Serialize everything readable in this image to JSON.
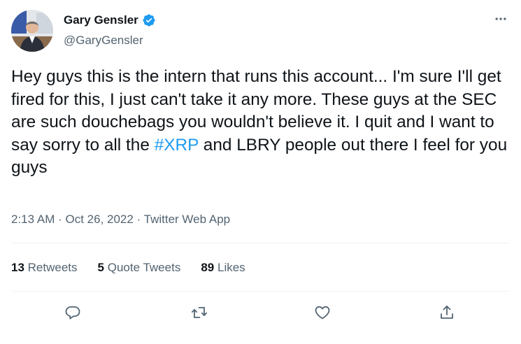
{
  "author": {
    "display_name": "Gary Gensler",
    "handle": "@GaryGensler"
  },
  "tweet": {
    "text_before": "Hey guys this is the intern that runs this account... I'm sure I'll get fired for this, I just can't take it any more. These guys at the SEC are such douchebags you wouldn't believe it. I quit and I want to say sorry to all the ",
    "hashtag": "#XRP",
    "text_after": " and LBRY people out there I feel for you guys"
  },
  "meta": {
    "time": "2:13 AM",
    "sep1": " · ",
    "date": "Oct 26, 2022",
    "sep2": " · ",
    "source": "Twitter Web App"
  },
  "stats": {
    "retweets_count": "13",
    "retweets_label": "Retweets",
    "quotes_count": "5",
    "quotes_label": "Quote Tweets",
    "likes_count": "89",
    "likes_label": "Likes"
  },
  "colors": {
    "accent": "#1d9bf0",
    "text": "#0f1419",
    "secondary": "#536471",
    "divider": "#eff3f4"
  },
  "icons": {
    "more": "more-dots-icon",
    "reply": "reply-icon",
    "retweet": "retweet-icon",
    "like": "heart-icon",
    "share": "share-icon",
    "verified": "verified-badge-icon"
  }
}
